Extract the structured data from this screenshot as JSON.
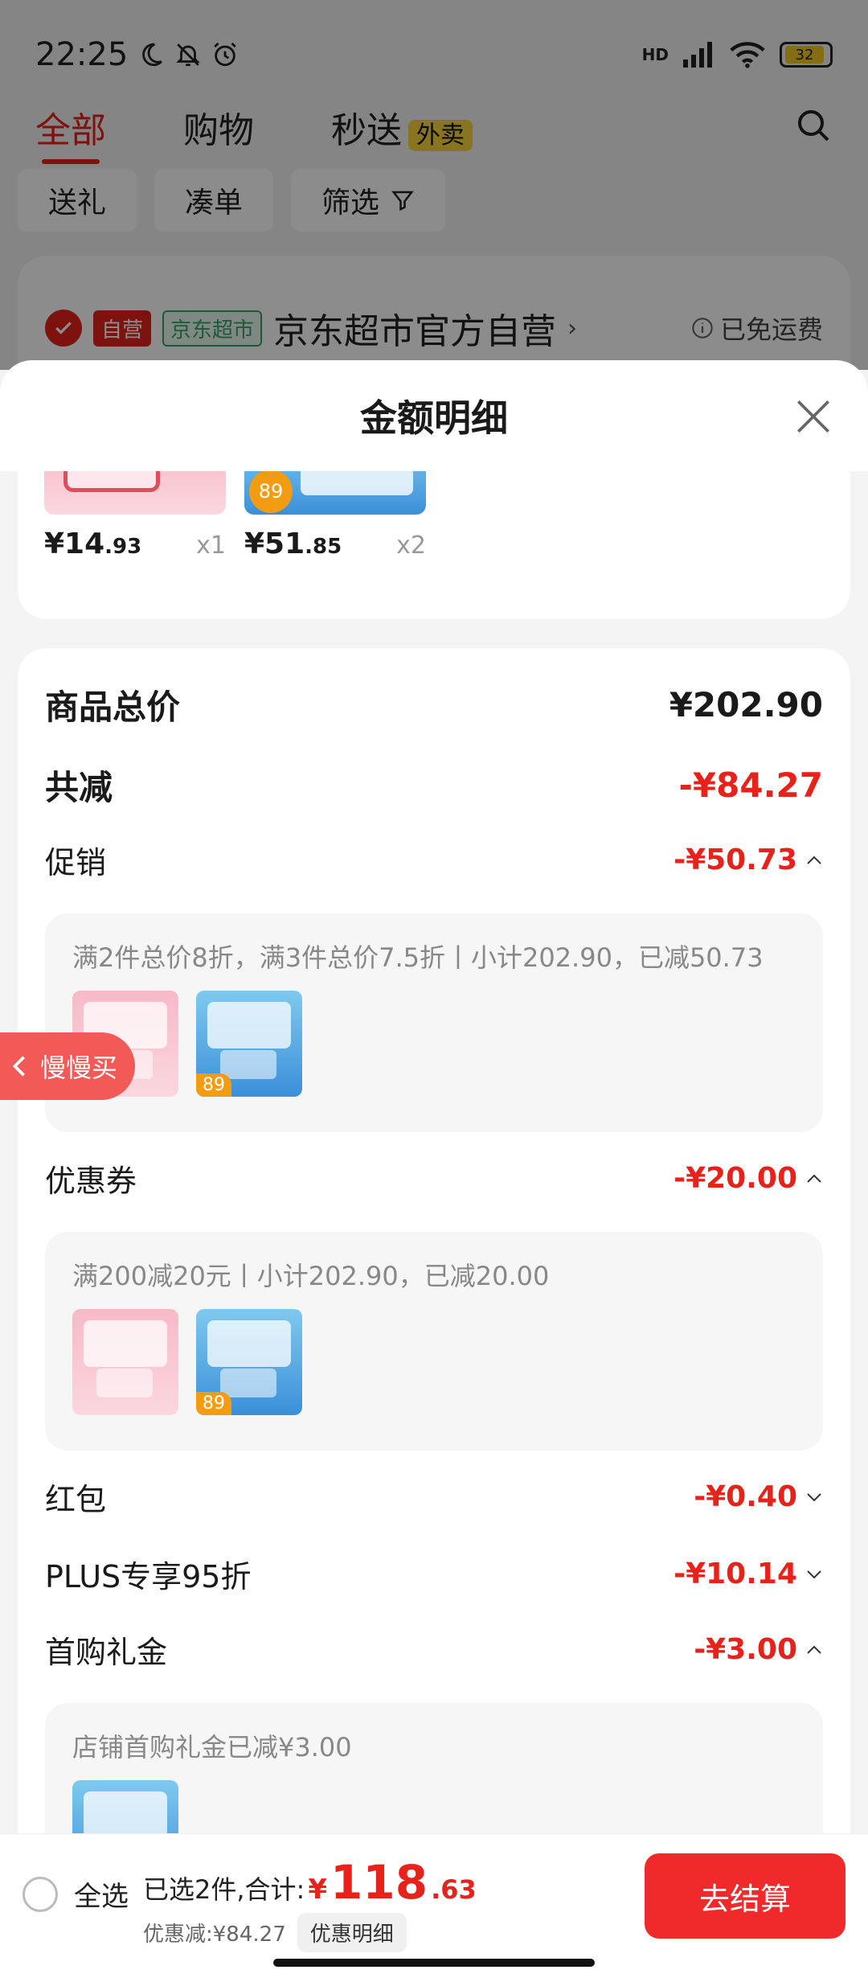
{
  "status_bar": {
    "time": "22:25",
    "network": "HD",
    "battery": "32"
  },
  "top_tabs": [
    {
      "label": "全部",
      "active": true
    },
    {
      "label": "购物",
      "active": false
    },
    {
      "label": "秒送",
      "badge": "外卖",
      "active": false
    }
  ],
  "filters": {
    "gift": "送礼",
    "bundle": "凑单",
    "filter": "筛选"
  },
  "store": {
    "tag_self": "自营",
    "tag_market": "京东超市",
    "name": "京东超市官方自营",
    "shipping": "已免运费"
  },
  "sheet": {
    "title": "金额明细",
    "items": [
      {
        "price_int": "¥14",
        "price_dec": ".93",
        "qty": "x1"
      },
      {
        "price_int": "¥51",
        "price_dec": ".85",
        "qty": "x2"
      }
    ],
    "float_label": "慢慢买",
    "total_label": "商品总价",
    "total_value": "¥202.90",
    "reduction_label": "共减",
    "reduction_value": "-¥84.27",
    "promo_label": "促销",
    "promo_value": "-¥50.73",
    "promo_desc": "满2件总价8折，满3件总价7.5折丨小计202.90，已减50.73",
    "coupon_label": "优惠券",
    "coupon_value": "-¥20.00",
    "coupon_desc": "满200减20元丨小计202.90，已减20.00",
    "redpacket_label": "红包",
    "redpacket_value": "-¥0.40",
    "plus_label": "PLUS专享95折",
    "plus_value": "-¥10.14",
    "firstbuy_label": "首购礼金",
    "firstbuy_value": "-¥3.00",
    "firstbuy_desc": "店铺首购礼金已减¥3.00",
    "thumb_badge": "89"
  },
  "bottom": {
    "select_all": "全选",
    "selected_text": "已选2件,合计:",
    "currency": "¥",
    "total_int": "118",
    "total_dec": ".63",
    "discount_text": "优惠减:¥84.27",
    "detail_link": "优惠明细",
    "checkout": "去结算"
  },
  "colors": {
    "accent": "#e6221b",
    "badge_yellow": "#f7d33c",
    "green": "#3aa36b"
  }
}
